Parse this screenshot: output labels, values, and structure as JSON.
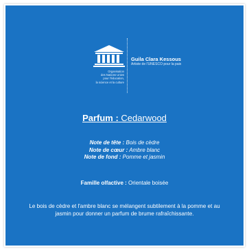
{
  "logo": {
    "org_lines": [
      "Organisation",
      "des Nations Unies",
      "pour l'éducation,",
      "la science et la culture"
    ],
    "person_name": "Guila Clara Kessous",
    "person_title": "Artiste de l'UNESCO pour la paix"
  },
  "title": {
    "prefix": "Parfum :",
    "name": "Cedarwood"
  },
  "notes": [
    {
      "label": "Note de tête :",
      "value": "Bois de cèdre"
    },
    {
      "label": "Note de cœur :",
      "value": "Ambre blanc"
    },
    {
      "label": "Note de fond :",
      "value": "Pomme et jasmin"
    }
  ],
  "family": {
    "label": "Famille olfactive :",
    "value": "Orientale boisée"
  },
  "description": "Le bois de cèdre et l'ambre blanc se mélangent subtilement à la pomme et au jasmin pour donner un parfum de brume rafraîchissante.",
  "colors": {
    "background": "#1a73c4",
    "text": "#ffffff"
  },
  "icons": [
    "unesco-temple-logo"
  ]
}
